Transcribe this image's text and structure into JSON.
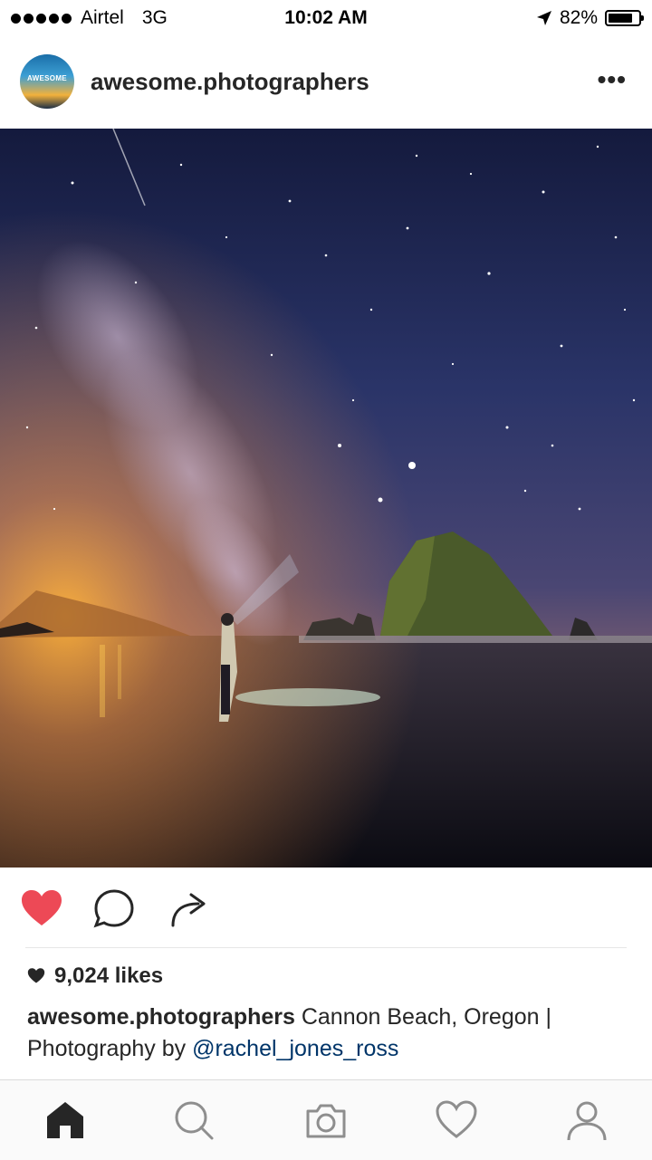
{
  "status_bar": {
    "carrier": "Airtel",
    "network": "3G",
    "time": "10:02 AM",
    "battery": "82%",
    "battery_level": 0.82
  },
  "post": {
    "username": "awesome.photographers",
    "avatar_text": "AWESOME",
    "more_label": "•••",
    "image_alt": "Milky Way night sky over Haystack Rock at Cannon Beach with a person holding a flashlight",
    "likes": "9,024 likes",
    "caption_user": "awesome.photographers",
    "caption_text": " Cannon Beach, Oregon | Photography by ",
    "caption_mention": "@rachel_jones_ross",
    "liked": true
  },
  "actions": {
    "icons": [
      "heart-icon",
      "comment-icon",
      "share-icon"
    ],
    "like_color": "#ed4956"
  },
  "tabbar": {
    "items": [
      "home-icon",
      "search-icon",
      "camera-icon",
      "activity-icon",
      "profile-icon"
    ]
  }
}
